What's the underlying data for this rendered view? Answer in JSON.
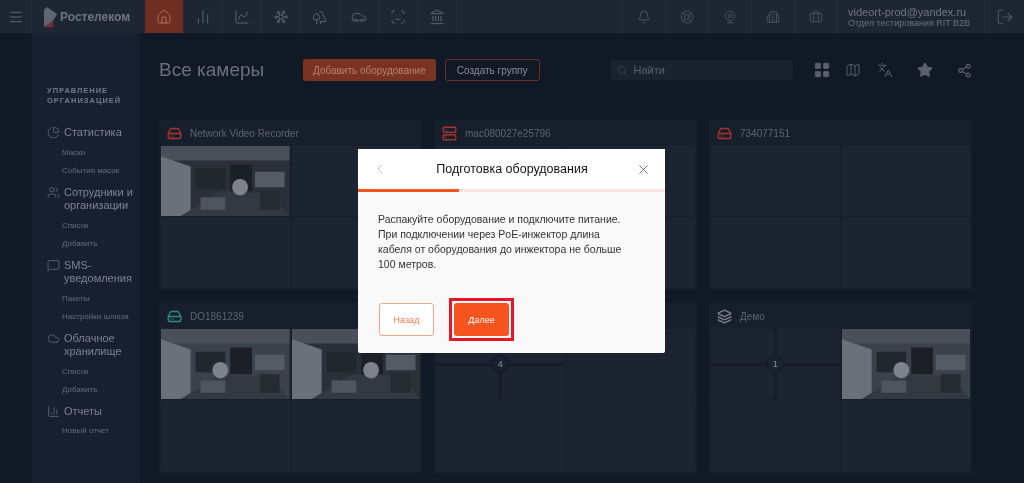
{
  "topbar": {
    "logo": "Ростелеком",
    "nav_tabs": [
      {
        "selected": true
      },
      {
        "selected": false
      },
      {
        "selected": false
      },
      {
        "selected": false
      },
      {
        "selected": false
      },
      {
        "selected": false
      },
      {
        "selected": false
      },
      {
        "selected": false
      }
    ],
    "user": {
      "email": "videort-prod@yandex.ru",
      "department": "Отдел тестирования RIT B2B"
    }
  },
  "sidebar": {
    "section_title": "УПРАВЛЕНИЕ ОРГАНИЗАЦИЕЙ",
    "groups": [
      {
        "title": "Статистика",
        "children": [
          {
            "label": "Маски"
          },
          {
            "label": "События масок"
          }
        ]
      },
      {
        "title": "Сотрудники и организации",
        "children": [
          {
            "label": "Список"
          },
          {
            "label": "Добавить"
          }
        ]
      },
      {
        "title": "SMS-уведомления",
        "children": [
          {
            "label": "Пакеты"
          },
          {
            "label": "Настройки шлюза"
          }
        ]
      },
      {
        "title": "Облачное хранилище",
        "children": [
          {
            "label": "Список"
          },
          {
            "label": "Добавить"
          }
        ]
      },
      {
        "title": "Отчеты",
        "children": [
          {
            "label": "Новый отчет"
          }
        ]
      }
    ]
  },
  "page": {
    "title": "Все камеры",
    "add_button": "Добавить оборудование",
    "group_button": "Создать группу",
    "search": {
      "placeholder": "Найти"
    }
  },
  "cards": [
    {
      "title": "Network Video Recorder",
      "kind": "recorder",
      "color": "#a8362f",
      "tiles": [
        {
          "kind": "picture"
        },
        {
          "kind": "empty"
        },
        {
          "kind": "empty"
        },
        {
          "kind": "empty"
        }
      ]
    },
    {
      "title": "mac080027e25796",
      "kind": "server",
      "color": "#a8362f",
      "tiles": [
        {
          "kind": "empty"
        },
        {
          "kind": "empty"
        },
        {
          "kind": "covered"
        },
        {
          "kind": "empty"
        }
      ]
    },
    {
      "title": "734077151",
      "kind": "recorder",
      "color": "#a8362f",
      "tiles": [
        {
          "kind": "empty"
        },
        {
          "kind": "empty"
        },
        {
          "kind": "empty"
        },
        {
          "kind": "empty"
        }
      ]
    },
    {
      "title": "DO1861239",
      "kind": "recorder",
      "color": "#2f8a86",
      "tiles": [
        {
          "kind": "picture"
        },
        {
          "kind": "picture"
        },
        {
          "kind": "empty"
        },
        {
          "kind": "empty"
        }
      ]
    },
    {
      "kind": "hidden",
      "tiles": [
        {
          "kind": "group",
          "count": "4"
        },
        {
          "kind": "empty"
        },
        {
          "kind": "empty"
        },
        {
          "kind": "empty"
        }
      ]
    },
    {
      "title": "Демо",
      "kind": "group",
      "color": "#7d838e",
      "tiles": [
        {
          "kind": "group",
          "count": "1"
        },
        {
          "kind": "picture"
        },
        {
          "kind": "empty"
        },
        {
          "kind": "empty"
        }
      ]
    }
  ],
  "modal": {
    "title": "Подготовка оборудования",
    "progress": {
      "level": 0.33
    },
    "text": "Распакуйте оборудование и подключите питание. При подключении через PoE-инжектор длина кабеля от оборудования до инжектора не больше 100 метров.",
    "buttons": [
      {
        "label": "Назад",
        "kind": "secondary",
        "highlighted": false
      },
      {
        "label": "Далее",
        "kind": "primary",
        "highlighted": true
      }
    ]
  }
}
